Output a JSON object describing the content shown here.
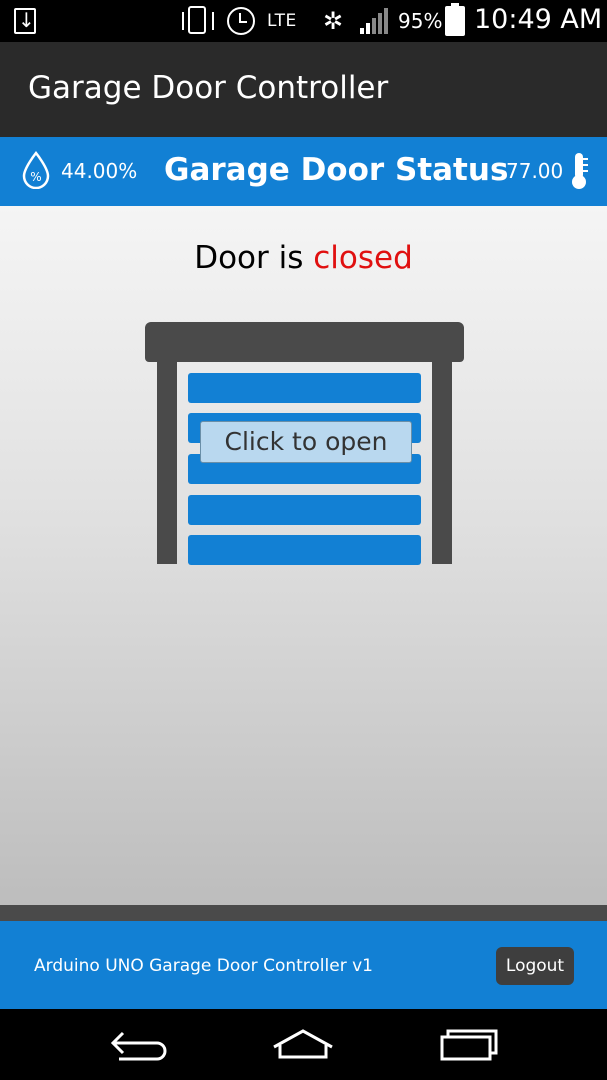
{
  "status_bar": {
    "network": "LTE",
    "battery": "95%",
    "time": "10:49 AM",
    "icons": [
      "download-icon",
      "vibrate-icon",
      "alarm-icon",
      "nfc-icon",
      "signal-icon",
      "battery-icon"
    ]
  },
  "app_bar": {
    "title": "Garage Door Controller"
  },
  "header": {
    "humidity": "44.00%",
    "title": "Garage Door Status",
    "temperature": "77.00",
    "humidity_symbol": "%"
  },
  "main": {
    "door_prefix": "Door is ",
    "door_state": "closed",
    "open_button_label": "Click to open"
  },
  "footer": {
    "text": "Arduino UNO Garage Door Controller v1",
    "logout_label": "Logout"
  },
  "colors": {
    "accent": "#1280d4",
    "dark": "#4a4a4a",
    "closed_state": "#e01010"
  }
}
